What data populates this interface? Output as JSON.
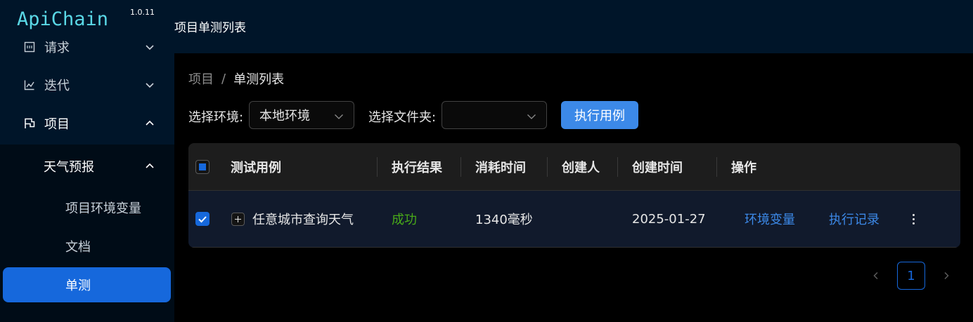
{
  "app": {
    "logo": "ApiChain",
    "version": "1.0.11"
  },
  "sidebar": {
    "items": [
      {
        "label": "请求",
        "icon": "request-icon"
      },
      {
        "label": "迭代",
        "icon": "line-chart-icon"
      },
      {
        "label": "项目",
        "icon": "project-flag-icon"
      }
    ],
    "subgroup": {
      "label": "天气预报"
    },
    "subitems": [
      {
        "label": "项目环境变量"
      },
      {
        "label": "文档"
      },
      {
        "label": "单测"
      }
    ]
  },
  "header": {
    "title": "项目单测列表"
  },
  "breadcrumb": {
    "items": [
      "项目",
      "单测列表"
    ],
    "separator": "/"
  },
  "filters": {
    "env_label": "选择环境:",
    "env_value": "本地环境",
    "folder_label": "选择文件夹:",
    "folder_value": ""
  },
  "actions": {
    "execute_label": "执行用例"
  },
  "table": {
    "columns": [
      "测试用例",
      "执行结果",
      "消耗时间",
      "创建人",
      "创建时间",
      "操作"
    ],
    "rows": [
      {
        "name": "任意城市查询天气",
        "result": "成功",
        "duration": "1340毫秒",
        "creator": "",
        "created_at": "2025-01-27",
        "actions": [
          "环境变量",
          "执行记录"
        ]
      }
    ]
  },
  "pagination": {
    "current_page": "1"
  },
  "colors": {
    "primary": "#1668dc",
    "button": "#3c89e8",
    "success": "#49aa19",
    "sidebar_bg": "#001529",
    "logo": "#5ad8e6"
  }
}
